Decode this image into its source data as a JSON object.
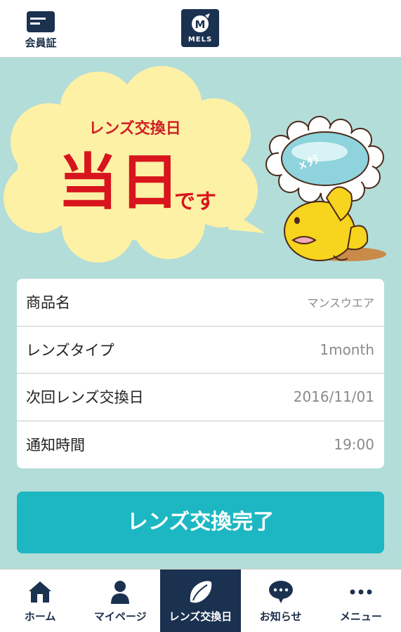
{
  "header": {
    "card_label": "会員証",
    "logo_letter": "M",
    "logo_text": "MELS",
    "card_icon": "membership-card-icon"
  },
  "hero": {
    "caption": "レンズ交換日",
    "main": "当日",
    "suffix": "です",
    "mascot_glasses_text": "ｘﾀﾗ",
    "colors": {
      "accent": "#d8141c",
      "cloud": "#fdf1a6",
      "background": "#b3ddd9"
    }
  },
  "info": {
    "rows": [
      {
        "label": "商品名",
        "value": "マンスウエア"
      },
      {
        "label": "レンズタイプ",
        "value": "1month"
      },
      {
        "label": "次回レンズ交換日",
        "value": "2016/11/01"
      },
      {
        "label": "通知時間",
        "value": "19:00"
      }
    ]
  },
  "complete_button": {
    "label": "レンズ交換完了",
    "color": "#1cb7c2"
  },
  "bottom_nav": {
    "active_index": 2,
    "items": [
      {
        "label": "ホーム",
        "icon": "home-icon"
      },
      {
        "label": "マイページ",
        "icon": "person-icon"
      },
      {
        "label": "レンズ交換日",
        "icon": "lens-icon"
      },
      {
        "label": "お知らせ",
        "icon": "speech-bubble-icon"
      },
      {
        "label": "メニュー",
        "icon": "more-dots-icon"
      }
    ]
  }
}
